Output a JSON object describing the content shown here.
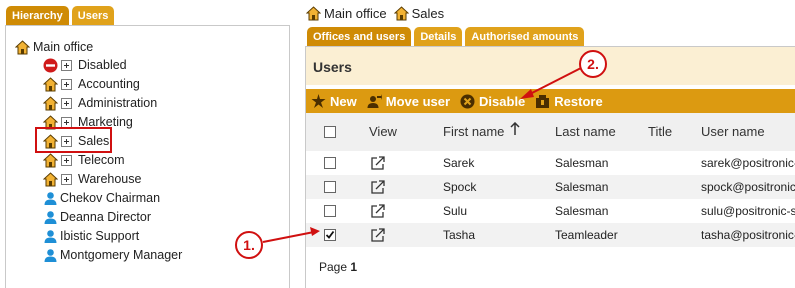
{
  "left": {
    "tabs": [
      {
        "label": "Hierarchy"
      },
      {
        "label": "Users"
      }
    ],
    "tree": {
      "root": {
        "label": "Main office"
      },
      "children": [
        {
          "label": "Disabled",
          "icon": "disabled-icon"
        },
        {
          "label": "Accounting",
          "icon": "house-icon"
        },
        {
          "label": "Administration",
          "icon": "house-icon"
        },
        {
          "label": "Marketing",
          "icon": "house-icon"
        },
        {
          "label": "Sales",
          "icon": "house-icon"
        },
        {
          "label": "Telecom",
          "icon": "house-icon"
        },
        {
          "label": "Warehouse",
          "icon": "house-icon"
        }
      ],
      "users": [
        {
          "label": "Chekov Chairman"
        },
        {
          "label": "Deanna Director"
        },
        {
          "label": "Ibistic Support"
        },
        {
          "label": "Montgomery Manager"
        }
      ]
    }
  },
  "breadcrumb": [
    {
      "label": "Main office"
    },
    {
      "label": "Sales"
    }
  ],
  "tabs": [
    {
      "label": "Offices and users"
    },
    {
      "label": "Details"
    },
    {
      "label": "Authorised amounts"
    }
  ],
  "section_title": "Users",
  "toolbar": {
    "new": "New",
    "move_user": "Move user",
    "disable": "Disable",
    "restore": "Restore"
  },
  "table": {
    "headers": {
      "view": "View",
      "first_name": "First name",
      "last_name": "Last name",
      "title": "Title",
      "user_name": "User name"
    },
    "rows": [
      {
        "first_name": "Sarek",
        "last_name": "Salesman",
        "title": "",
        "user_name": "sarek@positronic-",
        "checked": false
      },
      {
        "first_name": "Spock",
        "last_name": "Salesman",
        "title": "",
        "user_name": "spock@positronic-",
        "checked": false
      },
      {
        "first_name": "Sulu",
        "last_name": "Salesman",
        "title": "",
        "user_name": "sulu@positronic-s",
        "checked": false
      },
      {
        "first_name": "Tasha",
        "last_name": "Teamleader",
        "title": "",
        "user_name": "tasha@positronic-",
        "checked": true
      }
    ]
  },
  "pager": {
    "label": "Page",
    "number": "1"
  },
  "annotations": {
    "one": "1.",
    "two": "2."
  },
  "colors": {
    "accent": "#dc9a11",
    "tab_active": "#cf8b05",
    "annotation": "#d01010"
  }
}
